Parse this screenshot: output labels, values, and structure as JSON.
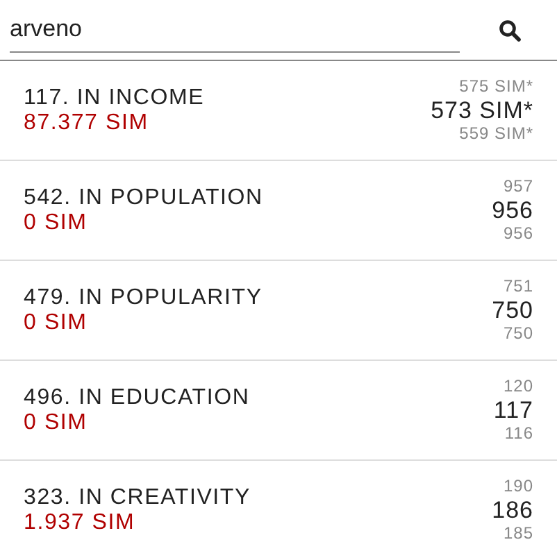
{
  "search": {
    "value": "arveno"
  },
  "rankings": [
    {
      "title": "117. IN INCOME",
      "value": "87.377 SIM",
      "above": "575 SIM*",
      "current": "573 SIM*",
      "below": "559 SIM*"
    },
    {
      "title": "542. IN POPULATION",
      "value": "0 SIM",
      "above": "957",
      "current": "956",
      "below": "956"
    },
    {
      "title": "479. IN POPULARITY",
      "value": "0 SIM",
      "above": "751",
      "current": "750",
      "below": "750"
    },
    {
      "title": "496. IN EDUCATION",
      "value": "0 SIM",
      "above": "120",
      "current": "117",
      "below": "116"
    },
    {
      "title": "323. IN CREATIVITY",
      "value": "1.937 SIM",
      "above": "190",
      "current": "186",
      "below": "185"
    }
  ]
}
